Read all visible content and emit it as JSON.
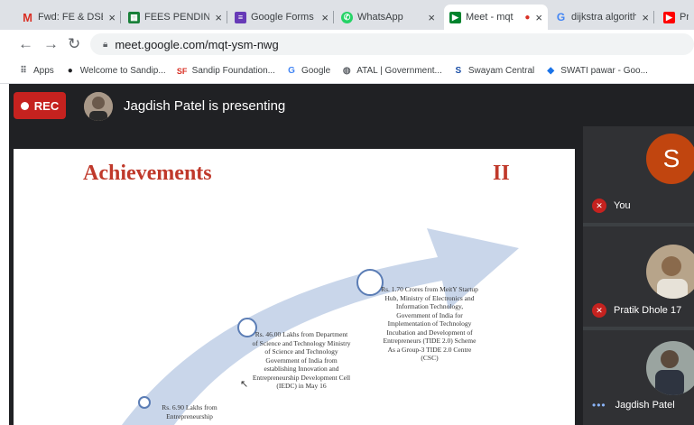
{
  "tabs": [
    {
      "title": "Fwd: FE & DSE",
      "favicon": "gmail-icon",
      "active": false
    },
    {
      "title": "FEES PENDING",
      "favicon": "sheets-icon",
      "active": false
    },
    {
      "title": "Google Forms",
      "favicon": "forms-icon",
      "active": false
    },
    {
      "title": "WhatsApp",
      "favicon": "whatsapp-icon",
      "active": false
    },
    {
      "title": "Meet - mqt",
      "favicon": "meet-icon",
      "active": true
    },
    {
      "title": "dijkstra algorithm",
      "favicon": "google-icon",
      "active": false
    },
    {
      "title": "Pr",
      "favicon": "youtube-icon",
      "active": false
    }
  ],
  "omnibox": {
    "url": "meet.google.com/mqt-ysm-nwg"
  },
  "bookmarks": [
    {
      "label": "Apps",
      "icon": "apps-grid-icon"
    },
    {
      "label": "Welcome to Sandip...",
      "icon": "github-icon"
    },
    {
      "label": "Sandip Foundation...",
      "icon": "sf-icon"
    },
    {
      "label": "Google",
      "icon": "google-icon"
    },
    {
      "label": "ATAL | Government...",
      "icon": "atal-icon"
    },
    {
      "label": "Swayam Central",
      "icon": "swayam-icon"
    },
    {
      "label": "SWATI pawar - Goo...",
      "icon": "diamond-icon"
    }
  ],
  "meet": {
    "rec_label": "REC",
    "presenter_text": "Jagdish Patel is presenting",
    "slide": {
      "title": "Achievements",
      "number": "II",
      "items": [
        {
          "text": "Rs. 1.70 Crores from MeitY Startup Hub, Ministry of Electronics and Information Technology, Government of India for Implementation of Technology Incubation and Development of Entrepreneurs (TIDE 2.0) Scheme As a Group-3 TIDE 2.0 Centre (CSC)"
        },
        {
          "text": "Rs. 46.00 Lakhs from Department of Science and Technology Ministry of Science and Technology Government of India from establishing Innovation and Entrepreneurship Development Cell (IEDC) in May 16"
        },
        {
          "text": "Rs. 6.90 Lakhs from Entrepreneurship"
        }
      ]
    },
    "participants": [
      {
        "name": "You",
        "avatar_letter": "S",
        "muted": true
      },
      {
        "name": "Pratik Dhole 17",
        "muted": true
      },
      {
        "name": "Jagdish Patel",
        "muted": false,
        "indicator": "more-dots-icon"
      }
    ]
  },
  "colors": {
    "rec": "#c5221f",
    "title": "#c0392b",
    "avatar_s": "#c1450f",
    "arrow": "#c9d6ea"
  }
}
